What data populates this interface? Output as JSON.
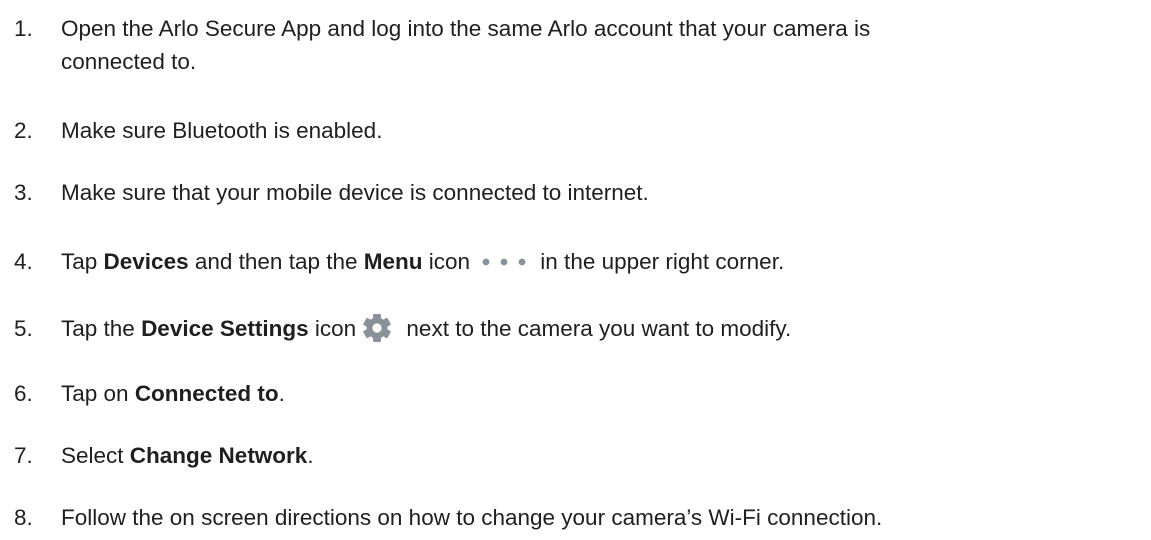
{
  "steps": [
    {
      "number": "1.",
      "line1": "Open the Arlo Secure App and log into the same Arlo account that your camera is",
      "line2": "connected to."
    },
    {
      "number": "2.",
      "text": "Make sure Bluetooth is enabled."
    },
    {
      "number": "3.",
      "text": "Make sure that your mobile device is connected to internet."
    },
    {
      "number": "4.",
      "t1": "Tap ",
      "b1": "Devices",
      "t2": " and then tap the ",
      "b2": "Menu",
      "t3": " icon",
      "icon": "menu-dots-icon",
      "t4": " in the  upper right corner."
    },
    {
      "number": "5.",
      "t1": "Tap the ",
      "b1": "Device Settings",
      "t2": " icon",
      "icon": "gear-icon",
      "t3": " next to the camera you want to modify."
    },
    {
      "number": "6.",
      "t1": "Tap on ",
      "b1": "Connected to",
      "t2": "."
    },
    {
      "number": "7.",
      "t1": "Select ",
      "b1": "Change Network",
      "t2": "."
    },
    {
      "number": "8.",
      "text": "Follow the on screen directions on how to change your camera’s Wi-Fi connection."
    }
  ],
  "colors": {
    "text": "#1f1f1f",
    "icon": "#8a9299"
  }
}
